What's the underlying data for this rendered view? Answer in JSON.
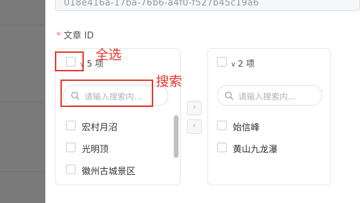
{
  "form": {
    "uuid_value": "018e416a-17ba-76b6-a4f0-f527b45c19a6",
    "field_label": "文章 ID",
    "required_mark": "*"
  },
  "transfer": {
    "left": {
      "count_label": "5 项",
      "search_placeholder": "请输入搜索内...",
      "items": [
        "宏村月沼",
        "光明顶",
        "徽州古城景区"
      ]
    },
    "right": {
      "count_label": "2 项",
      "search_placeholder": "请输入搜索内...",
      "items": [
        "始信峰",
        "黄山九龙瀑"
      ]
    },
    "to_right_icon": "chevron-right-icon",
    "to_left_icon": "chevron-left-icon"
  },
  "annotations": {
    "select_all": "全选",
    "search": "搜索",
    "color": "#e8332b"
  }
}
